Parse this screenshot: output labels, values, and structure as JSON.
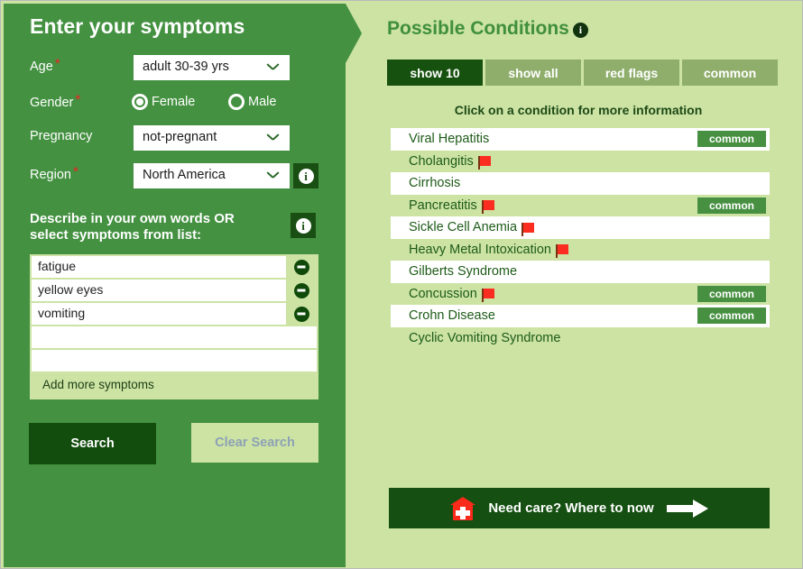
{
  "left": {
    "title": "Enter your symptoms",
    "fields": {
      "age": {
        "label": "Age",
        "value": "adult 30-39 yrs",
        "required": true
      },
      "gender": {
        "label": "Gender",
        "required": true,
        "options": [
          {
            "label": "Female",
            "selected": true
          },
          {
            "label": "Male",
            "selected": false
          }
        ]
      },
      "pregnancy": {
        "label": "Pregnancy",
        "value": "not-pregnant",
        "required": false
      },
      "region": {
        "label": "Region",
        "value": "North America",
        "required": true
      }
    },
    "describe_heading": "Describe in your own words OR select symptoms from list:",
    "symptoms": [
      "fatigue",
      "yellow eyes",
      "vomiting",
      "",
      ""
    ],
    "add_more_label": "Add more symptoms",
    "search_label": "Search",
    "clear_label": "Clear Search",
    "info_icon": "info-icon",
    "minus_icon": "minus-circle-icon",
    "chevron_icon": "chevron-down-icon"
  },
  "right": {
    "title": "Possible Conditions",
    "title_info_icon": "info-icon",
    "tabs": [
      {
        "label": "show 10",
        "active": true
      },
      {
        "label": "show all",
        "active": false
      },
      {
        "label": "red flags",
        "active": false
      },
      {
        "label": "common",
        "active": false
      }
    ],
    "click_hint": "Click on a condition for more information",
    "conditions": [
      {
        "name": "Viral Hepatitis",
        "red_flag": false,
        "common": true
      },
      {
        "name": "Cholangitis",
        "red_flag": true,
        "common": false
      },
      {
        "name": "Cirrhosis",
        "red_flag": false,
        "common": false
      },
      {
        "name": "Pancreatitis",
        "red_flag": true,
        "common": true
      },
      {
        "name": "Sickle Cell Anemia",
        "red_flag": true,
        "common": false
      },
      {
        "name": "Heavy Metal Intoxication",
        "red_flag": true,
        "common": false
      },
      {
        "name": "Gilberts Syndrome",
        "red_flag": false,
        "common": false
      },
      {
        "name": "Concussion",
        "red_flag": true,
        "common": true
      },
      {
        "name": "Crohn Disease",
        "red_flag": false,
        "common": true
      },
      {
        "name": "Cyclic Vomiting Syndrome",
        "red_flag": false,
        "common": false
      }
    ],
    "common_badge_label": "common",
    "red_flag_icon": "red-flag-icon",
    "need_care": {
      "label": "Need care?  Where to now",
      "icon": "hospital-house-icon",
      "arrow_icon": "arrow-right-icon"
    }
  },
  "colors": {
    "panel_green": "#449141",
    "page_bg_green": "#cce3a4",
    "dark_green": "#154f11",
    "tab_inactive": "#8fae6c",
    "title_green": "#3f8f3c",
    "red_flag": "#fb2d20",
    "required_star": "#ee2222",
    "clear_text": "#8da1b5"
  }
}
